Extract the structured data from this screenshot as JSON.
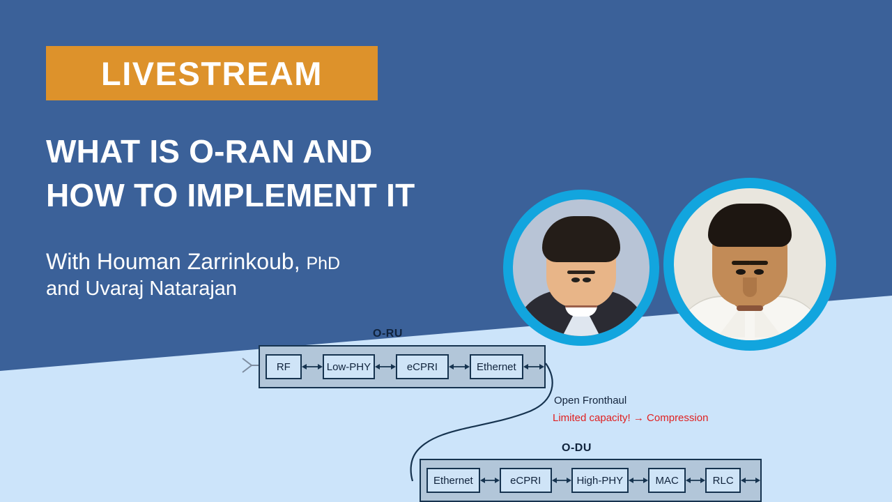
{
  "slide": {
    "background_dark": "#3b6199",
    "background_light": "#cce4fa",
    "badge_color": "#dd922b",
    "accent_ring": "#12a5de"
  },
  "badge": {
    "label": "LIVESTREAM"
  },
  "headline": {
    "line1": "WHAT IS O-RAN AND",
    "line2": "HOW TO IMPLEMENT IT"
  },
  "presenters": {
    "line1_main": "With Houman Zarrinkoub,",
    "line1_suffix": "PhD",
    "line2": "and Uvaraj Natarajan",
    "avatars": [
      {
        "name": "Houman Zarrinkoub"
      },
      {
        "name": "Uvaraj Natarajan"
      }
    ]
  },
  "diagram": {
    "oru": {
      "label": "O-RU",
      "blocks": [
        "RF",
        "Low-PHY",
        "eCPRI",
        "Ethernet"
      ]
    },
    "odu": {
      "label": "O-DU",
      "blocks": [
        "Ethernet",
        "eCPRI",
        "High-PHY",
        "MAC",
        "RLC"
      ]
    },
    "annotations": {
      "fronthaul": "Open Fronthaul",
      "capacity": "Limited capacity! → Compression",
      "capacity_color": "#e02020"
    },
    "box_fill": "#cfe4f7",
    "container_fill": "#b2c6d9",
    "stroke": "#16334f"
  }
}
